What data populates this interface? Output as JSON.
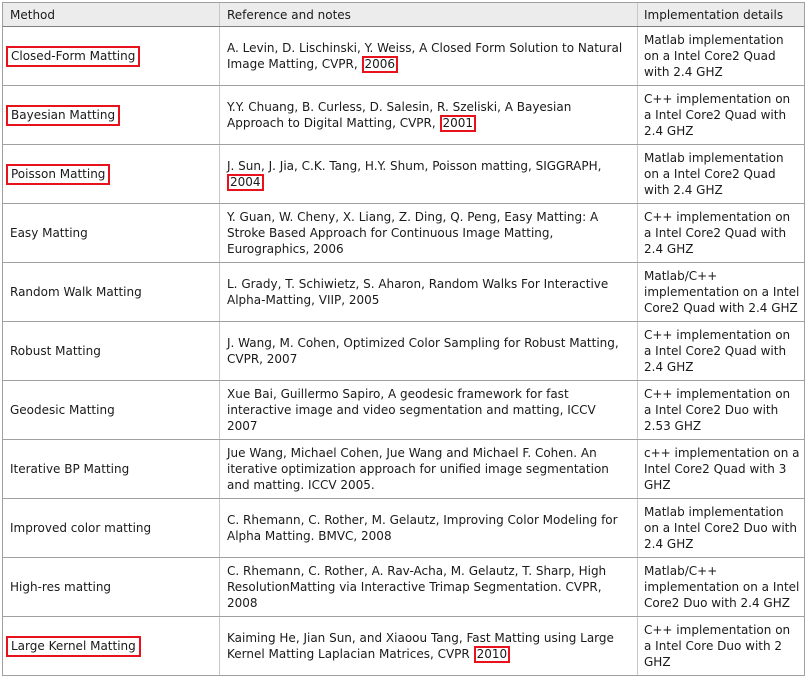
{
  "header": {
    "method": "Method",
    "reference": "Reference and notes",
    "implementation": "Implementation details"
  },
  "rows": [
    {
      "method": "Closed-Form Matting",
      "boxed": true,
      "ref": "A. Levin, D. Lischinski, Y. Weiss, A Closed Form Solution to Natural Image Matting, CVPR, ",
      "year": "2006",
      "year_boxed": true,
      "impl": "Matlab implementation on a Intel Core2 Quad with 2.4 GHZ"
    },
    {
      "method": "Bayesian Matting",
      "boxed": true,
      "ref": "Y.Y. Chuang, B. Curless, D. Salesin, R. Szeliski, A Bayesian Approach to Digital Matting, CVPR, ",
      "year": "2001",
      "year_boxed": true,
      "impl": "C++ implementation on a Intel Core2 Quad with 2.4 GHZ"
    },
    {
      "method": "Poisson Matting",
      "boxed": true,
      "ref": "J. Sun, J. Jia, C.K. Tang, H.Y. Shum, Poisson matting, SIGGRAPH, ",
      "year": "2004",
      "year_boxed": true,
      "impl": "Matlab implementation on a Intel Core2 Quad with 2.4 GHZ"
    },
    {
      "method": "Easy Matting",
      "boxed": false,
      "ref": "Y. Guan, W. Cheny, X. Liang, Z. Ding, Q. Peng, Easy Matting: A Stroke Based Approach for Continuous Image Matting, Eurographics, 2006",
      "year": "",
      "year_boxed": false,
      "impl": "C++ implementation on a Intel Core2 Quad with 2.4 GHZ"
    },
    {
      "method": "Random Walk Matting",
      "boxed": false,
      "ref": "L. Grady, T. Schiwietz, S. Aharon, Random Walks For Interactive Alpha-Matting, VIIP, 2005",
      "year": "",
      "year_boxed": false,
      "impl": "Matlab/C++ implementation on a Intel Core2 Quad with 2.4 GHZ"
    },
    {
      "method": "Robust Matting",
      "boxed": false,
      "ref": "J. Wang, M. Cohen, Optimized Color Sampling for Robust Matting, CVPR, 2007",
      "year": "",
      "year_boxed": false,
      "impl": "C++ implementation on a Intel Core2 Quad with 2.4 GHZ"
    },
    {
      "method": "Geodesic Matting",
      "boxed": false,
      "ref": "Xue Bai, Guillermo Sapiro, A geodesic framework for fast interactive image and video segmentation and matting, ICCV 2007",
      "year": "",
      "year_boxed": false,
      "impl": "C++ implementation on a Intel Core2 Duo with 2.53 GHZ"
    },
    {
      "method": "Iterative BP Matting",
      "boxed": false,
      "ref": "Jue Wang, Michael Cohen, Jue Wang and Michael F. Cohen. An iterative optimization approach for unified image segmentation and matting. ICCV 2005.",
      "year": "",
      "year_boxed": false,
      "impl": "c++ implementation on a Intel Core2 Quad with 3 GHZ"
    },
    {
      "method": "Improved color matting",
      "boxed": false,
      "ref": "C. Rhemann, C. Rother, M. Gelautz, Improving Color Modeling for Alpha Matting. BMVC, 2008",
      "year": "",
      "year_boxed": false,
      "impl": "Matlab implementation on a Intel Core2 Duo with 2.4 GHZ"
    },
    {
      "method": "High-res matting",
      "boxed": false,
      "ref": "C. Rhemann, C. Rother, A. Rav-Acha, M. Gelautz, T. Sharp, High ResolutionMatting via Interactive Trimap Segmentation. CVPR, 2008",
      "year": "",
      "year_boxed": false,
      "impl": "Matlab/C++ implementation on a Intel Core2 Duo with 2.4 GHZ"
    },
    {
      "method": "Large Kernel Matting",
      "boxed": true,
      "ref": "Kaiming He, Jian Sun, and Xiaoou Tang, Fast Matting using Large Kernel Matting Laplacian Matrices, CVPR ",
      "year": "2010",
      "year_boxed": true,
      "impl": "C++ implementation on a Intel Core Duo with 2 GHZ"
    }
  ],
  "colors": {
    "highlight_box": "#e8121c",
    "header_bg": "#ececec",
    "grid": "#a0a0a0"
  }
}
